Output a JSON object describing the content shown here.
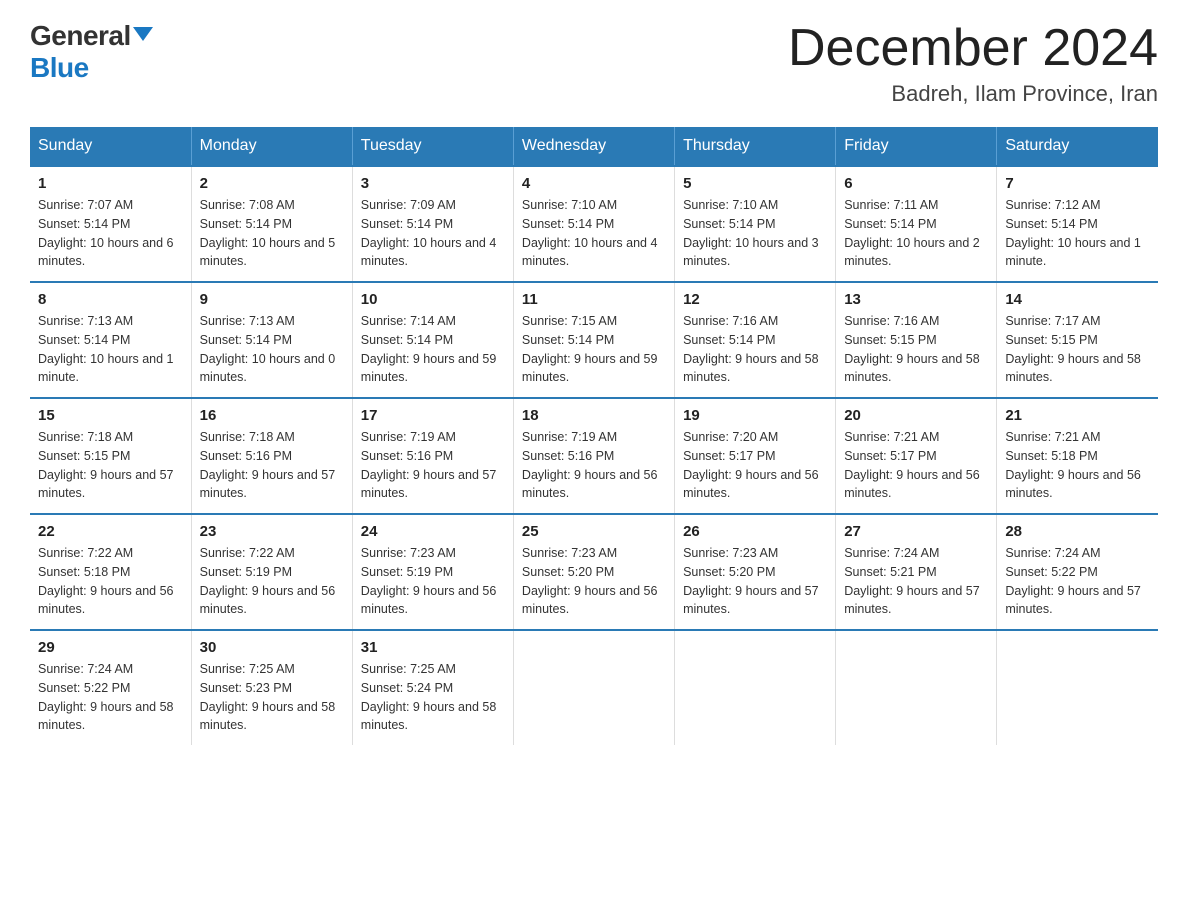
{
  "logo": {
    "general": "General",
    "blue": "Blue",
    "triangle": true
  },
  "header": {
    "month_year": "December 2024",
    "location": "Badreh, Ilam Province, Iran"
  },
  "weekdays": [
    "Sunday",
    "Monday",
    "Tuesday",
    "Wednesday",
    "Thursday",
    "Friday",
    "Saturday"
  ],
  "weeks": [
    [
      {
        "day": "1",
        "sunrise": "7:07 AM",
        "sunset": "5:14 PM",
        "daylight": "10 hours and 6 minutes."
      },
      {
        "day": "2",
        "sunrise": "7:08 AM",
        "sunset": "5:14 PM",
        "daylight": "10 hours and 5 minutes."
      },
      {
        "day": "3",
        "sunrise": "7:09 AM",
        "sunset": "5:14 PM",
        "daylight": "10 hours and 4 minutes."
      },
      {
        "day": "4",
        "sunrise": "7:10 AM",
        "sunset": "5:14 PM",
        "daylight": "10 hours and 4 minutes."
      },
      {
        "day": "5",
        "sunrise": "7:10 AM",
        "sunset": "5:14 PM",
        "daylight": "10 hours and 3 minutes."
      },
      {
        "day": "6",
        "sunrise": "7:11 AM",
        "sunset": "5:14 PM",
        "daylight": "10 hours and 2 minutes."
      },
      {
        "day": "7",
        "sunrise": "7:12 AM",
        "sunset": "5:14 PM",
        "daylight": "10 hours and 1 minute."
      }
    ],
    [
      {
        "day": "8",
        "sunrise": "7:13 AM",
        "sunset": "5:14 PM",
        "daylight": "10 hours and 1 minute."
      },
      {
        "day": "9",
        "sunrise": "7:13 AM",
        "sunset": "5:14 PM",
        "daylight": "10 hours and 0 minutes."
      },
      {
        "day": "10",
        "sunrise": "7:14 AM",
        "sunset": "5:14 PM",
        "daylight": "9 hours and 59 minutes."
      },
      {
        "day": "11",
        "sunrise": "7:15 AM",
        "sunset": "5:14 PM",
        "daylight": "9 hours and 59 minutes."
      },
      {
        "day": "12",
        "sunrise": "7:16 AM",
        "sunset": "5:14 PM",
        "daylight": "9 hours and 58 minutes."
      },
      {
        "day": "13",
        "sunrise": "7:16 AM",
        "sunset": "5:15 PM",
        "daylight": "9 hours and 58 minutes."
      },
      {
        "day": "14",
        "sunrise": "7:17 AM",
        "sunset": "5:15 PM",
        "daylight": "9 hours and 58 minutes."
      }
    ],
    [
      {
        "day": "15",
        "sunrise": "7:18 AM",
        "sunset": "5:15 PM",
        "daylight": "9 hours and 57 minutes."
      },
      {
        "day": "16",
        "sunrise": "7:18 AM",
        "sunset": "5:16 PM",
        "daylight": "9 hours and 57 minutes."
      },
      {
        "day": "17",
        "sunrise": "7:19 AM",
        "sunset": "5:16 PM",
        "daylight": "9 hours and 57 minutes."
      },
      {
        "day": "18",
        "sunrise": "7:19 AM",
        "sunset": "5:16 PM",
        "daylight": "9 hours and 56 minutes."
      },
      {
        "day": "19",
        "sunrise": "7:20 AM",
        "sunset": "5:17 PM",
        "daylight": "9 hours and 56 minutes."
      },
      {
        "day": "20",
        "sunrise": "7:21 AM",
        "sunset": "5:17 PM",
        "daylight": "9 hours and 56 minutes."
      },
      {
        "day": "21",
        "sunrise": "7:21 AM",
        "sunset": "5:18 PM",
        "daylight": "9 hours and 56 minutes."
      }
    ],
    [
      {
        "day": "22",
        "sunrise": "7:22 AM",
        "sunset": "5:18 PM",
        "daylight": "9 hours and 56 minutes."
      },
      {
        "day": "23",
        "sunrise": "7:22 AM",
        "sunset": "5:19 PM",
        "daylight": "9 hours and 56 minutes."
      },
      {
        "day": "24",
        "sunrise": "7:23 AM",
        "sunset": "5:19 PM",
        "daylight": "9 hours and 56 minutes."
      },
      {
        "day": "25",
        "sunrise": "7:23 AM",
        "sunset": "5:20 PM",
        "daylight": "9 hours and 56 minutes."
      },
      {
        "day": "26",
        "sunrise": "7:23 AM",
        "sunset": "5:20 PM",
        "daylight": "9 hours and 57 minutes."
      },
      {
        "day": "27",
        "sunrise": "7:24 AM",
        "sunset": "5:21 PM",
        "daylight": "9 hours and 57 minutes."
      },
      {
        "day": "28",
        "sunrise": "7:24 AM",
        "sunset": "5:22 PM",
        "daylight": "9 hours and 57 minutes."
      }
    ],
    [
      {
        "day": "29",
        "sunrise": "7:24 AM",
        "sunset": "5:22 PM",
        "daylight": "9 hours and 58 minutes."
      },
      {
        "day": "30",
        "sunrise": "7:25 AM",
        "sunset": "5:23 PM",
        "daylight": "9 hours and 58 minutes."
      },
      {
        "day": "31",
        "sunrise": "7:25 AM",
        "sunset": "5:24 PM",
        "daylight": "9 hours and 58 minutes."
      },
      null,
      null,
      null,
      null
    ]
  ],
  "labels": {
    "sunrise": "Sunrise:",
    "sunset": "Sunset:",
    "daylight": "Daylight:"
  }
}
